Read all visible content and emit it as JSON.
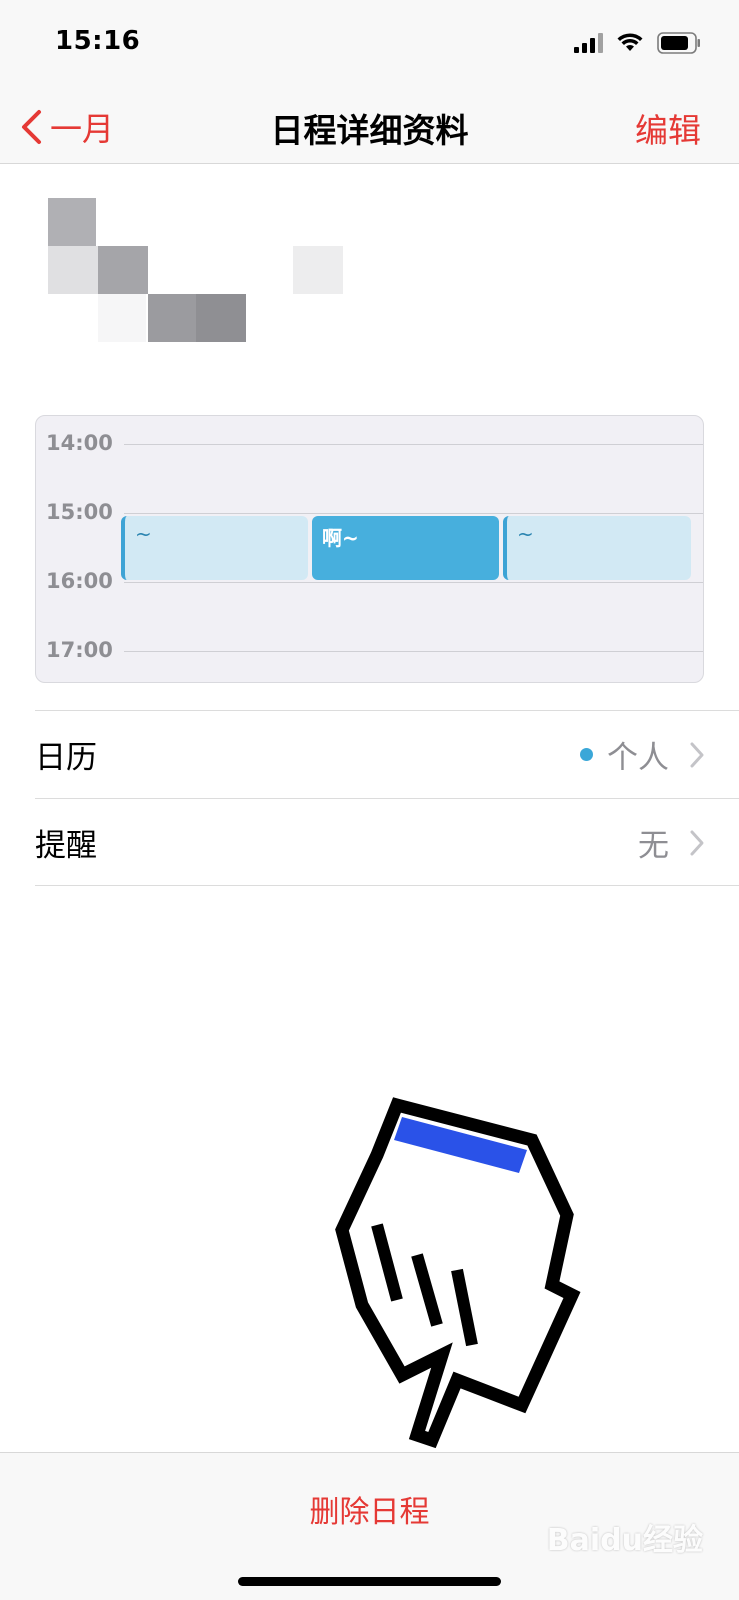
{
  "status_bar": {
    "time": "15:16"
  },
  "nav": {
    "back_label": "一月",
    "title": "日程详细资料",
    "edit_label": "编辑"
  },
  "timeline": {
    "hours": [
      "14:00",
      "15:00",
      "16:00",
      "17:00"
    ],
    "events": [
      {
        "label": "~",
        "selected": false
      },
      {
        "label": "啊~",
        "selected": true
      },
      {
        "label": "~",
        "selected": false
      }
    ]
  },
  "rows": [
    {
      "label": "日历",
      "value": "个人",
      "dot_color": "#3aa7d8"
    },
    {
      "label": "提醒",
      "value": "无"
    }
  ],
  "toolbar": {
    "delete_label": "删除日程"
  },
  "watermark": {
    "text": "Baidu经验"
  }
}
